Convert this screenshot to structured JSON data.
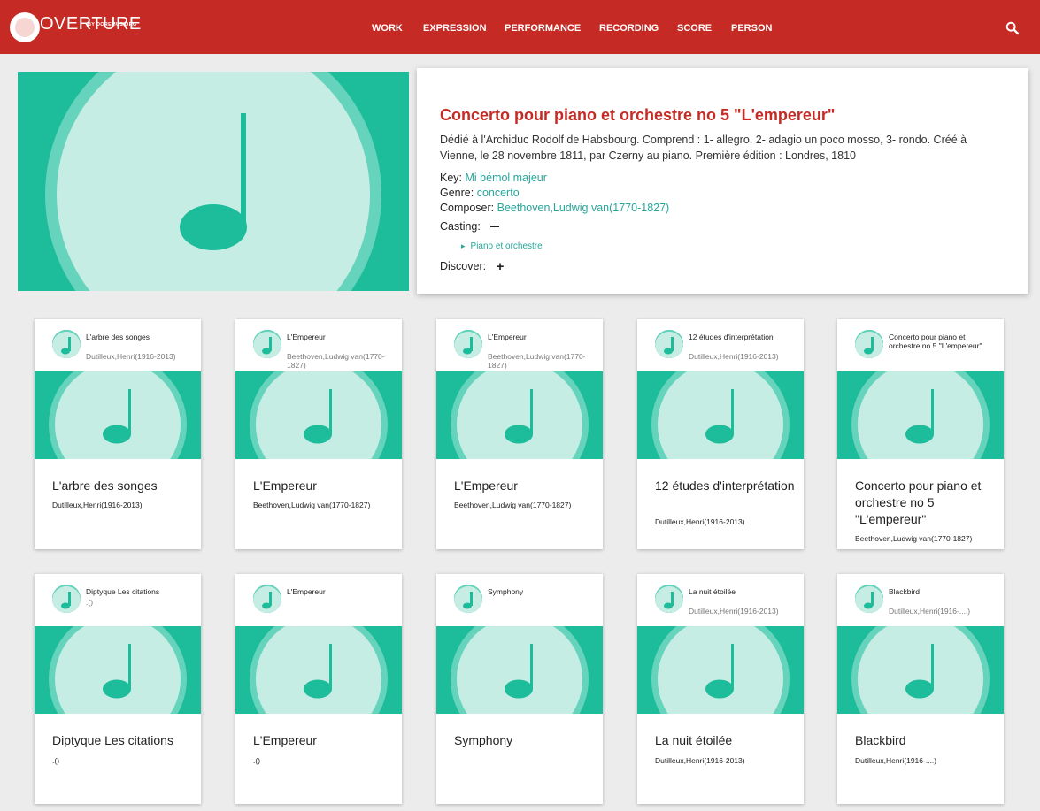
{
  "brand": {
    "name": "OVERTURE",
    "sub": "BY DOREMUS.ORG"
  },
  "nav": [
    "WORK",
    "EXPRESSION",
    "PERFORMANCE",
    "RECORDING",
    "SCORE",
    "PERSON"
  ],
  "colors": {
    "header": "#c62a25",
    "accent_red": "#c62a25",
    "teal": "#1dbc9a",
    "link": "#26a69a",
    "background": "#ececec"
  },
  "icons": {
    "search": "search-icon",
    "note": "music-note-icon"
  },
  "work": {
    "title": "Concerto pour piano et orchestre no 5 \"L'empereur\"",
    "description": "Dédié à l'Archiduc Rodolf de Habsbourg. Comprend : 1- allegro, 2- adagio un poco mosso, 3- rondo. Créé à Vienne, le 28 novembre 1811, par Czerny au piano. Première édition : Londres, 1810",
    "key_label": "Key:",
    "key_value": "Mi bémol majeur",
    "genre_label": "Genre:",
    "genre_value": "concerto",
    "composer_label": "Composer:",
    "composer_value": "Beethoven,Ludwig van(1770-1827)",
    "casting_label": "Casting:",
    "casting_item": "Piano et orchestre",
    "discover_label": "Discover:"
  },
  "cards": [
    {
      "small_title": "L'arbre des songes",
      "small_sub": "Dutilleux,Henri(1916-2013)",
      "title": "L'arbre des songes",
      "composer": "Dutilleux,Henri(1916-2013)"
    },
    {
      "small_title": "L'Empereur",
      "small_sub": "Beethoven,Ludwig van(1770-1827)",
      "title": "L'Empereur",
      "composer": "Beethoven,Ludwig van(1770-1827)"
    },
    {
      "small_title": "L'Empereur",
      "small_sub": "Beethoven,Ludwig van(1770-1827)",
      "title": "L'Empereur",
      "composer": "Beethoven,Ludwig van(1770-1827)"
    },
    {
      "small_title": "12 études d'interprétation",
      "small_sub": "Dutilleux,Henri(1916-2013)",
      "title": "12 études d'interprétation",
      "composer": "Dutilleux,Henri(1916-2013)"
    },
    {
      "small_title": "Concerto pour piano et orchestre no 5 \"L'empereur\"",
      "small_sub": "",
      "title": "Concerto pour piano et orchestre no 5 \"L'empereur\"",
      "composer": "Beethoven,Ludwig van(1770-1827)"
    },
    {
      "small_title": "Diptyque Les citations",
      "small_sub": ".()",
      "title": "Diptyque Les citations",
      "composer": ".()"
    },
    {
      "small_title": "L'Empereur",
      "small_sub": ".()",
      "title": "L'Empereur",
      "composer": ".()"
    },
    {
      "small_title": "Symphony",
      "small_sub": "",
      "title": "Symphony",
      "composer": ""
    },
    {
      "small_title": "La nuit étoilée",
      "small_sub": "Dutilleux,Henri(1916-2013)",
      "title": "La nuit étoilée",
      "composer": "Dutilleux,Henri(1916-2013)"
    },
    {
      "small_title": "Blackbird",
      "small_sub": "Dutilleux,Henri(1916-....)",
      "title": "Blackbird",
      "composer": "Dutilleux,Henri(1916-....)"
    }
  ]
}
